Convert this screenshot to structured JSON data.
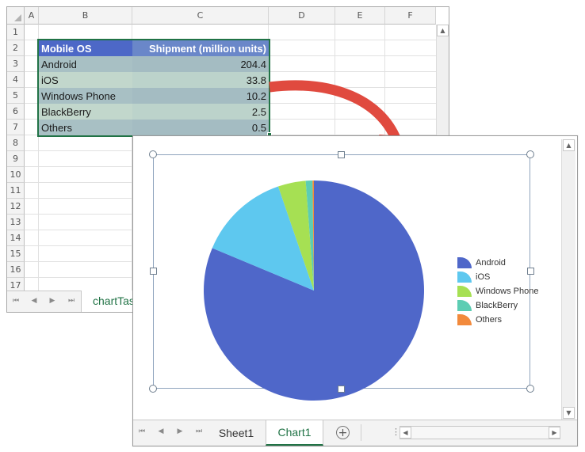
{
  "back_sheet": {
    "columns": [
      "A",
      "B",
      "C",
      "D",
      "E",
      "F"
    ],
    "rows": [
      "1",
      "2",
      "3",
      "4",
      "5",
      "6",
      "7",
      "8",
      "9",
      "10",
      "11",
      "12",
      "13",
      "14",
      "15",
      "16",
      "17"
    ],
    "table_headers": [
      "Mobile OS",
      "Shipment (million units)"
    ],
    "table_rows": [
      {
        "os": "Android",
        "value": "204.4"
      },
      {
        "os": "iOS",
        "value": "33.8"
      },
      {
        "os": "Windows Phone",
        "value": "10.2"
      },
      {
        "os": "BlackBerry",
        "value": "2.5"
      },
      {
        "os": "Others",
        "value": "0.5"
      }
    ],
    "active_tab": "chartTas"
  },
  "chart_sheet": {
    "tabs": [
      {
        "label": "Sheet1",
        "active": false
      },
      {
        "label": "Chart1",
        "active": true
      }
    ],
    "add_sheet_icon": "plus-circle-icon"
  },
  "chart_data": {
    "type": "pie",
    "categories": [
      "Android",
      "iOS",
      "Windows Phone",
      "BlackBerry",
      "Others"
    ],
    "values": [
      204.4,
      33.8,
      10.2,
      2.5,
      0.5
    ],
    "colors": [
      "#4f67c9",
      "#5ec8ef",
      "#a6e053",
      "#5ccdb3",
      "#f28a3c"
    ],
    "legend_position": "right",
    "title": ""
  },
  "colors": {
    "accent_green": "#217346",
    "arrow_red": "#e04a3f"
  }
}
